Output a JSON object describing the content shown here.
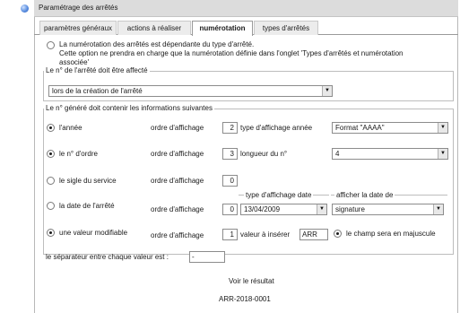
{
  "window": {
    "title": "Paramétrage des arrêtés"
  },
  "tabs": [
    {
      "label": "paramètres généraux"
    },
    {
      "label": "actions à réaliser"
    },
    {
      "label": "numérotation"
    },
    {
      "label": "types d'arrêtés"
    }
  ],
  "dependence": {
    "line1": "La numérotation des arrêtés est dépendante du type d'arrêté.",
    "line2": "Cette option ne prendra en charge que la numérotation définie dans l'onglet 'Types d'arrêtés et numérotation",
    "line3": "associée'"
  },
  "affect": {
    "legend": "Le n° de l'arrêté doit être affecté",
    "value": "lors de la création de l'arrêté"
  },
  "content": {
    "legend": "Le n° généré doit contenir les informations suivantes",
    "order_label": "ordre d'affichage",
    "rows": {
      "year": {
        "label": "l'année",
        "order": "2",
        "type_label": "type d'affichage année",
        "type_value": "Format \"AAAA\""
      },
      "ordre": {
        "label": "le n° d'ordre",
        "order": "3",
        "length_label": "longueur du n°",
        "length_value": "4"
      },
      "sigle": {
        "label": "le sigle du service",
        "order": "0"
      },
      "date": {
        "label": "la date de l'arrêté",
        "order": "0",
        "type_label": "type d'affichage date",
        "type_value": "13/04/2009",
        "display_label": "afficher la date de",
        "display_value": "signature"
      },
      "custom": {
        "label": "une valeur modifiable",
        "order": "1",
        "insert_label": "valeur à insérer",
        "insert_value": "ARR",
        "uppercase_label": "le champ sera en majuscule"
      }
    }
  },
  "separator": {
    "label": "le séparateur entre chaque valeur est :",
    "value": "-"
  },
  "result": {
    "link": "Voir le résultat",
    "value": "ARR-2018-0001"
  }
}
